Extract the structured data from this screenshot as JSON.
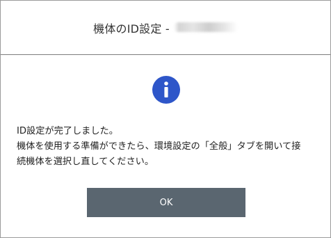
{
  "dialog": {
    "title": "機体のID設定 -",
    "title_blurred_suffix": "DMX-1EX",
    "icon": "info-icon",
    "message_lines": [
      "ID設定が完了しました。",
      "機体を使用する準備ができたら、環境設定の「全般」タブを開いて接",
      "続機体を選択し直してください。"
    ],
    "ok_label": "OK"
  },
  "colors": {
    "icon_blue": "#2e56c9",
    "button_bg": "#5a6670",
    "border": "#9a9a9a"
  }
}
